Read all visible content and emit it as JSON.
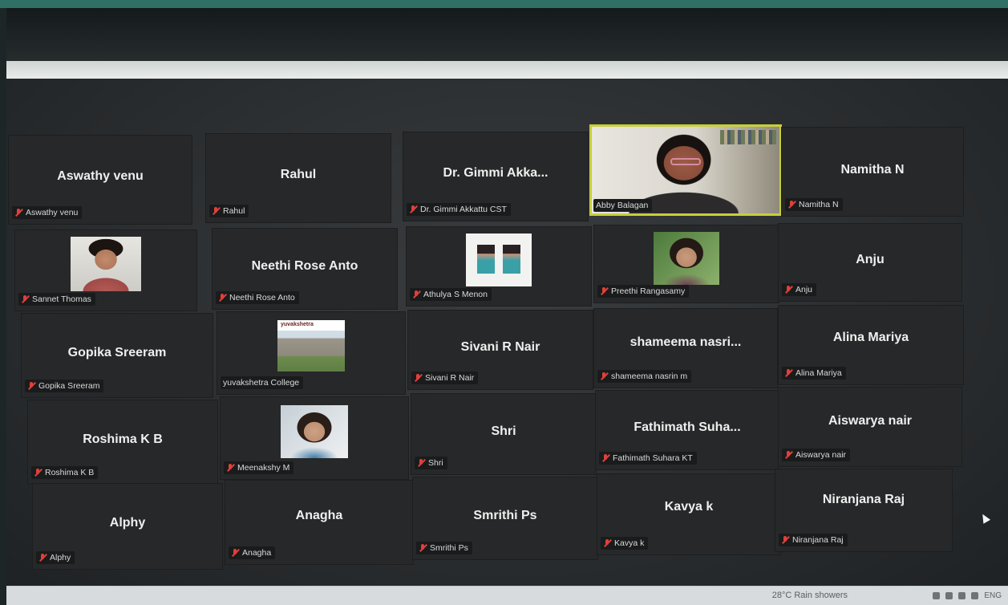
{
  "participants": [
    {
      "name": "Aswathy venu",
      "display": "Aswathy venu"
    },
    {
      "name": "Rahul",
      "display": "Rahul"
    },
    {
      "name": "Dr. Gimmi Akkattu CST",
      "display": "Dr. Gimmi Akka..."
    },
    {
      "name": "Abby Balagan",
      "display": ""
    },
    {
      "name": "Namitha N",
      "display": "Namitha N"
    },
    {
      "name": "Sannet Thomas",
      "display": ""
    },
    {
      "name": "Neethi Rose Anto",
      "display": "Neethi Rose Anto"
    },
    {
      "name": "Athulya S Menon",
      "display": ""
    },
    {
      "name": "Preethi Rangasamy",
      "display": ""
    },
    {
      "name": "Anju",
      "display": "Anju"
    },
    {
      "name": "Gopika Sreeram",
      "display": "Gopika Sreeram"
    },
    {
      "name": "yuvakshetra College",
      "display": ""
    },
    {
      "name": "Sivani R Nair",
      "display": "Sivani R Nair"
    },
    {
      "name": "shameema nasrin m",
      "display": "shameema nasri..."
    },
    {
      "name": "Alina Mariya",
      "display": "Alina Mariya"
    },
    {
      "name": "Roshima K B",
      "display": "Roshima K B"
    },
    {
      "name": "Meenakshy M",
      "display": ""
    },
    {
      "name": "Shri",
      "display": "Shri"
    },
    {
      "name": "Fathimath Suhara KT",
      "display": "Fathimath Suha..."
    },
    {
      "name": "Aiswarya nair",
      "display": "Aiswarya nair"
    },
    {
      "name": "Alphy",
      "display": "Alphy"
    },
    {
      "name": "Anagha",
      "display": "Anagha"
    },
    {
      "name": "Smrithi Ps",
      "display": "Smrithi Ps"
    },
    {
      "name": "Kavya k",
      "display": "Kavya k"
    },
    {
      "name": "Niranjana Raj",
      "display": "Niranjana Raj"
    }
  ],
  "college_logo_text": "yuvakshetra",
  "taskbar": {
    "weather": "28°C  Rain showers",
    "lang": "ENG"
  }
}
